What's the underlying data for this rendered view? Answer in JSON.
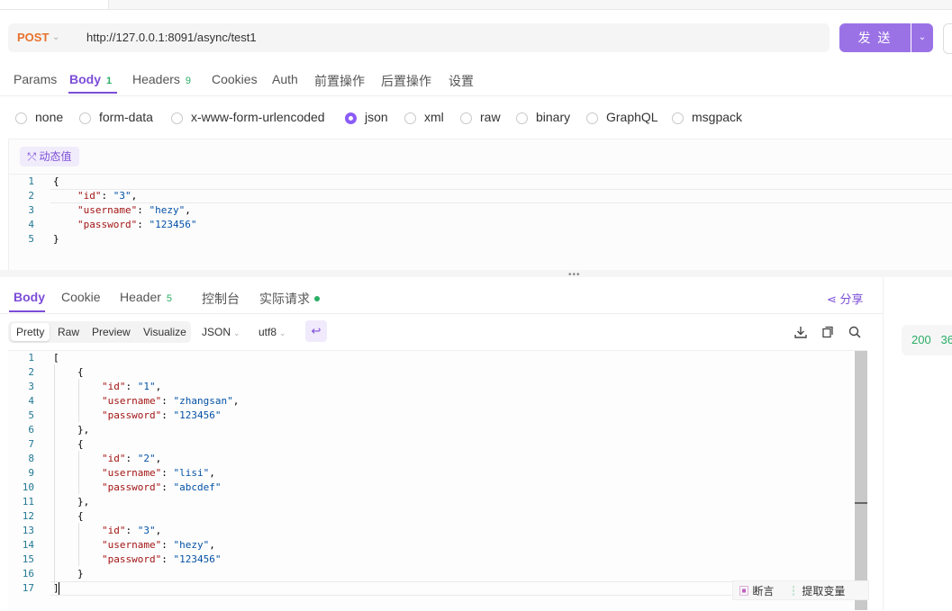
{
  "request": {
    "method": "POST",
    "url": "http://127.0.0.1:8091/async/test1",
    "send_label": "发 送"
  },
  "request_tabs": [
    {
      "label": "Params"
    },
    {
      "label": "Body",
      "badge": "1"
    },
    {
      "label": "Headers",
      "badge": "9"
    },
    {
      "label": "Cookies"
    },
    {
      "label": "Auth"
    },
    {
      "label": "前置操作"
    },
    {
      "label": "后置操作"
    },
    {
      "label": "设置"
    }
  ],
  "body_types": [
    "none",
    "form-data",
    "x-www-form-urlencoded",
    "json",
    "xml",
    "raw",
    "binary",
    "GraphQL",
    "msgpack"
  ],
  "selected_body_type": "json",
  "dynamic_value_label": "动态值",
  "request_body": {
    "line_numbers": [
      "1",
      "2",
      "3",
      "4",
      "5"
    ],
    "open": "{",
    "close": "}",
    "fields": [
      {
        "key": "\"id\"",
        "value": "\"3\""
      },
      {
        "key": "\"username\"",
        "value": "\"hezy\""
      },
      {
        "key": "\"password\"",
        "value": "\"123456\""
      }
    ]
  },
  "response_tabs": [
    {
      "label": "Body"
    },
    {
      "label": "Cookie"
    },
    {
      "label": "Header",
      "badge": "5"
    },
    {
      "label": "控制台"
    },
    {
      "label": "实际请求"
    }
  ],
  "share_label": "分享",
  "view_modes": [
    "Pretty",
    "Raw",
    "Preview",
    "Visualize"
  ],
  "format": "JSON",
  "encoding": "utf8",
  "response_body": {
    "line_numbers": [
      "1",
      "2",
      "3",
      "4",
      "5",
      "6",
      "7",
      "8",
      "9",
      "10",
      "11",
      "12",
      "13",
      "14",
      "15",
      "16",
      "17"
    ],
    "items": [
      {
        "id": "\"1\"",
        "username": "\"zhangsan\"",
        "password": "\"123456\""
      },
      {
        "id": "\"2\"",
        "username": "\"lisi\"",
        "password": "\"abcdef\""
      },
      {
        "id": "\"3\"",
        "username": "\"hezy\"",
        "password": "\"123456\""
      }
    ]
  },
  "float_actions": {
    "assert": "断言",
    "extract": "提取变量"
  },
  "status_code": "200",
  "status_partial": "36",
  "colors": {
    "accent": "#7c4dd8",
    "send": "#9b72e6",
    "method": "#e8722c",
    "success": "#2bae66"
  }
}
